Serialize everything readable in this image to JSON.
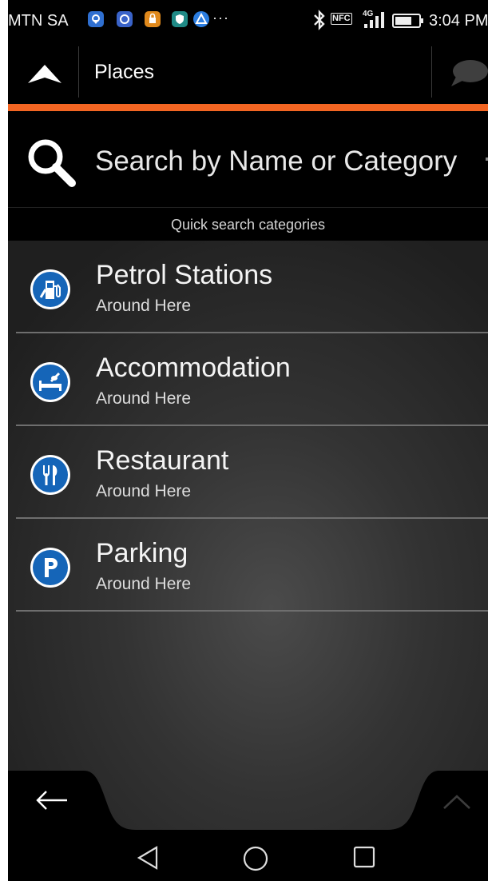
{
  "status_bar": {
    "carrier": "MTN SA",
    "notification_icons": [
      "location-icon",
      "app-icon",
      "lock-app-icon",
      "shield-icon",
      "maps-icon"
    ],
    "more": "···",
    "network": "4G",
    "nfc": "NFC",
    "time": "3:04 PM"
  },
  "header": {
    "title": "Places"
  },
  "search": {
    "placeholder": "Search by Name or Category"
  },
  "quick_search": {
    "label": "Quick search categories"
  },
  "categories": [
    {
      "title": "Petrol Stations",
      "subtitle": "Around Here",
      "icon": "fuel-pump-icon"
    },
    {
      "title": "Accommodation",
      "subtitle": "Around Here",
      "icon": "bed-icon"
    },
    {
      "title": "Restaurant",
      "subtitle": "Around Here",
      "icon": "fork-knife-icon"
    },
    {
      "title": "Parking",
      "subtitle": "Around Here",
      "icon": "parking-icon"
    }
  ],
  "colors": {
    "accent": "#f26522",
    "icon_blue": "#1565b8",
    "background": "#2b2b2b"
  }
}
